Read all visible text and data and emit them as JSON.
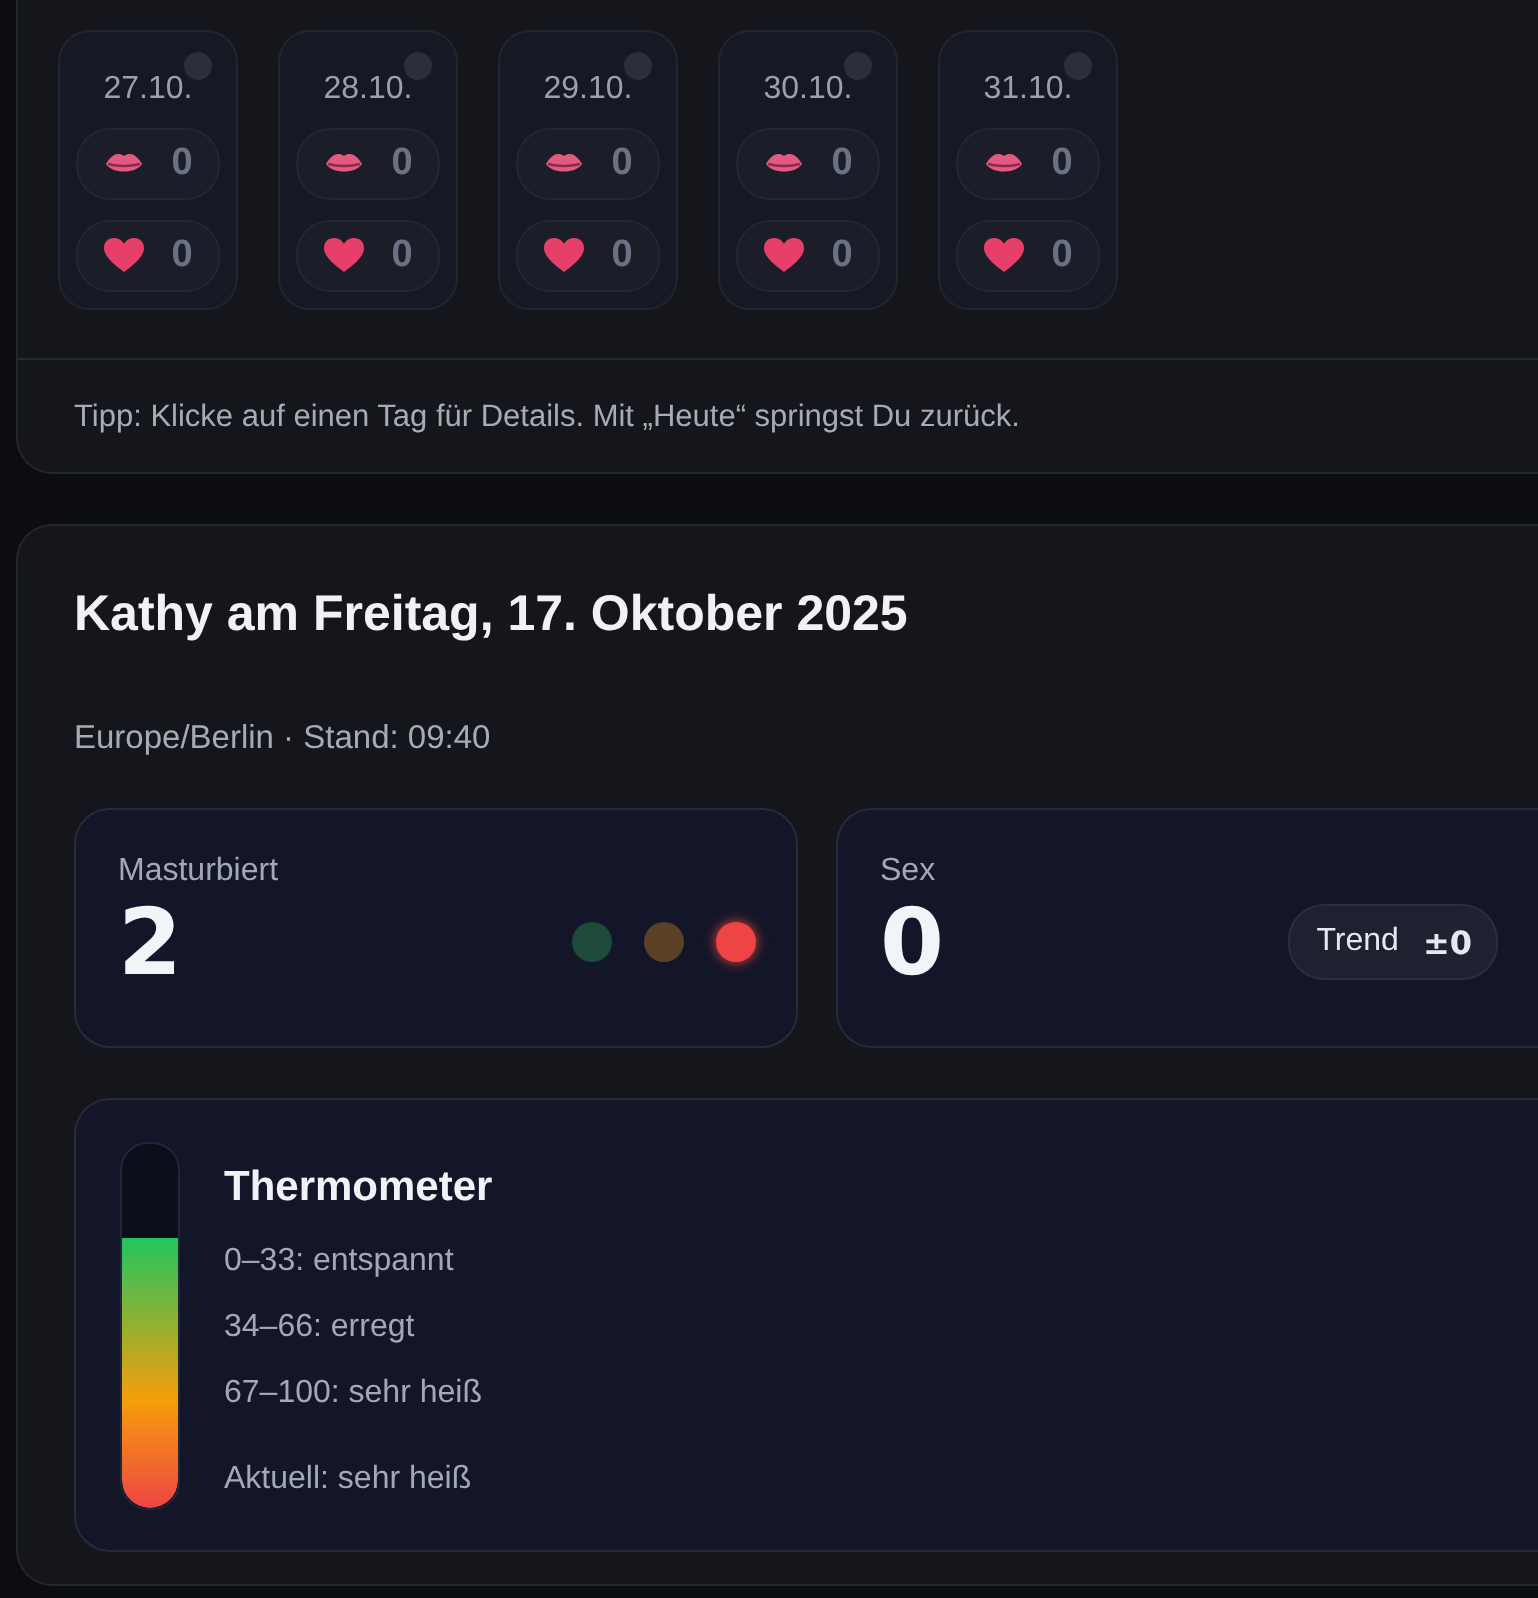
{
  "calendar": {
    "days": [
      {
        "date": "27.10.",
        "lips": "0",
        "hearts": "0"
      },
      {
        "date": "28.10.",
        "lips": "0",
        "hearts": "0"
      },
      {
        "date": "29.10.",
        "lips": "0",
        "hearts": "0"
      },
      {
        "date": "30.10.",
        "lips": "0",
        "hearts": "0"
      },
      {
        "date": "31.10.",
        "lips": "0",
        "hearts": "0"
      }
    ],
    "tip": "Tipp: Klicke auf einen Tag für Details. Mit „Heute“ springst Du zurück."
  },
  "detail": {
    "title": "Kathy am Freitag, 17. Oktober 2025",
    "subtitle": "Europe/Berlin · Stand: 09:40",
    "stats": [
      {
        "kind": "dots",
        "label": "Masturbiert",
        "value": "2",
        "dots": [
          {
            "color": "#1d4a39",
            "on": false
          },
          {
            "color": "#5a4024",
            "on": false
          },
          {
            "color": "#ef4444",
            "on": true
          }
        ]
      },
      {
        "kind": "trend",
        "label": "Sex",
        "value": "0",
        "trend_label": "Trend",
        "trend_value": "±0"
      }
    ],
    "thermometer": {
      "title": "Thermometer",
      "level": 0.74,
      "ranges": [
        "0–33: entspannt",
        "34–66: erregt",
        "67–100: sehr heiß"
      ],
      "current": "Aktuell: sehr heiß"
    }
  }
}
